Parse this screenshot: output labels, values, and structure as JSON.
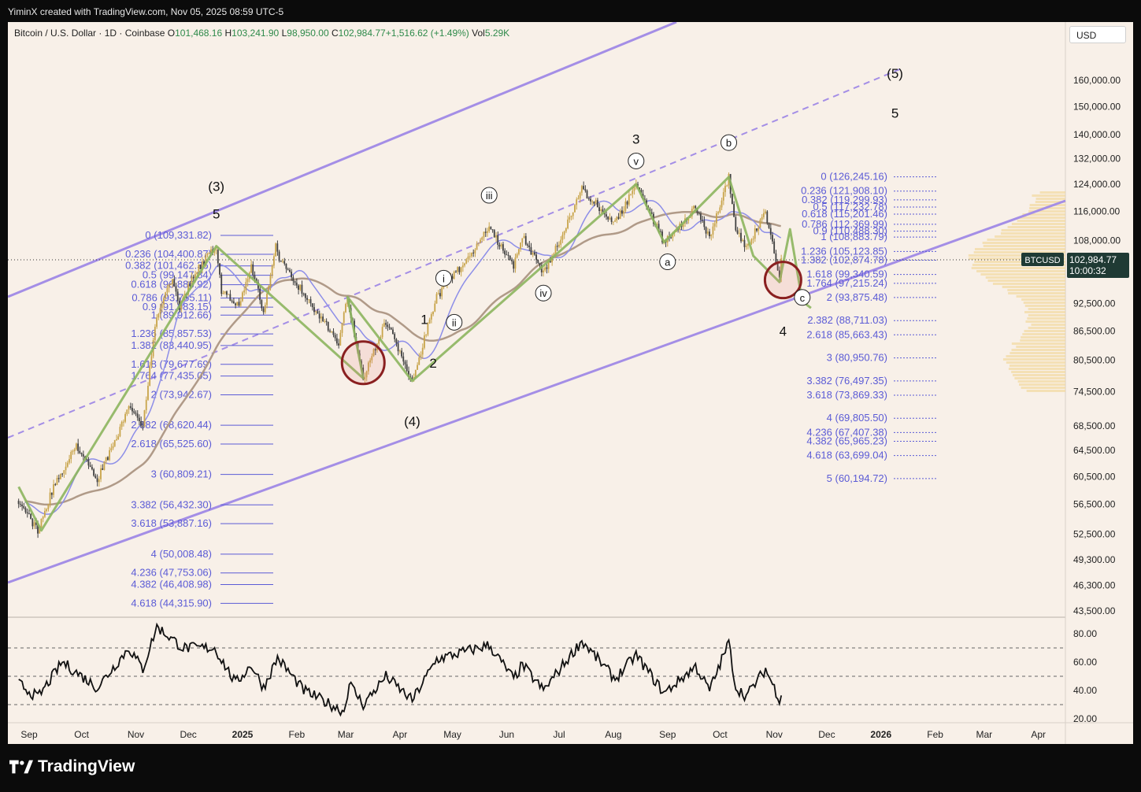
{
  "header": "YiminX created with TradingView.com, Nov 05, 2025 08:59 UTC-5",
  "brand": "TradingView",
  "symbol": {
    "title": "Bitcoin / U.S. Dollar · 1D · Coinbase",
    "o_label": "O",
    "o": "101,468.16",
    "h_label": "H",
    "h": "103,241.90",
    "l_label": "L",
    "l": "98,950.00",
    "c_label": "C",
    "c": "102,984.77",
    "change": "+1,516.62 (+1.49%)",
    "vol_label": "Vol",
    "vol": "5.29K"
  },
  "currency": "USD",
  "price_tag": {
    "symbol": "BTCUSD",
    "price": "102,984.77",
    "countdown": "10:00:32"
  },
  "colors": {
    "up": "#c8a44a",
    "down": "#404040",
    "channel": "#a48ee6",
    "wave": "#8cb55e",
    "ma_slow": "#b09a88",
    "ma_fast": "#8d8ee8",
    "fib": "#5b5bd6",
    "circle": "#8a2020"
  },
  "chart_data": {
    "type": "line",
    "title": "Bitcoin / U.S. Dollar · 1D · Coinbase",
    "y_scale": "log",
    "price_axis_labels": [
      "160,000.00",
      "150,000.00",
      "140,000.00",
      "132,000.00",
      "124,000.00",
      "116,000.00",
      "108,000.00",
      "92,500.00",
      "86,500.00",
      "80,500.00",
      "74,500.00",
      "68,500.00",
      "64,500.00",
      "60,500.00",
      "56,500.00",
      "52,500.00",
      "49,300.00",
      "46,300.00",
      "43,500.00"
    ],
    "rsi_axis_labels": [
      "80.00",
      "60.00",
      "40.00",
      "20.00"
    ],
    "time_axis_labels": [
      "Sep",
      "Oct",
      "Nov",
      "Dec",
      "2025",
      "Feb",
      "Mar",
      "Apr",
      "May",
      "Jun",
      "Jul",
      "Aug",
      "Sep",
      "Oct",
      "Nov",
      "Dec",
      "2026",
      "Feb",
      "Mar",
      "Apr"
    ],
    "price_waypoints": [
      [
        "2024-08-26",
        57000
      ],
      [
        "2024-09-06",
        53000
      ],
      [
        "2024-09-15",
        59000
      ],
      [
        "2024-09-28",
        65500
      ],
      [
        "2024-10-10",
        60000
      ],
      [
        "2024-10-29",
        72000
      ],
      [
        "2024-11-05",
        68500
      ],
      [
        "2024-11-12",
        88000
      ],
      [
        "2024-11-22",
        98500
      ],
      [
        "2024-11-26",
        91500
      ],
      [
        "2024-12-05",
        100000
      ],
      [
        "2024-12-17",
        106500
      ],
      [
        "2024-12-20",
        95000
      ],
      [
        "2024-12-30",
        92500
      ],
      [
        "2025-01-06",
        101500
      ],
      [
        "2025-01-13",
        90500
      ],
      [
        "2025-01-20",
        106500
      ],
      [
        "2025-01-22",
        103000
      ],
      [
        "2025-02-03",
        96000
      ],
      [
        "2025-02-25",
        84000
      ],
      [
        "2025-03-02",
        94000
      ],
      [
        "2025-03-11",
        77000
      ],
      [
        "2025-03-24",
        88500
      ],
      [
        "2025-04-08",
        76500
      ],
      [
        "2025-04-22",
        94000
      ],
      [
        "2025-05-09",
        103000
      ],
      [
        "2025-05-22",
        111500
      ],
      [
        "2025-06-05",
        101000
      ],
      [
        "2025-06-10",
        109500
      ],
      [
        "2025-06-22",
        99500
      ],
      [
        "2025-07-03",
        109500
      ],
      [
        "2025-07-14",
        122500
      ],
      [
        "2025-08-02",
        112500
      ],
      [
        "2025-08-14",
        124000
      ],
      [
        "2025-08-30",
        107500
      ],
      [
        "2025-09-17",
        117000
      ],
      [
        "2025-09-25",
        108500
      ],
      [
        "2025-10-06",
        126200
      ],
      [
        "2025-10-10",
        110500
      ],
      [
        "2025-10-16",
        106000
      ],
      [
        "2025-10-27",
        115500
      ],
      [
        "2025-11-04",
        99000
      ],
      [
        "2025-11-05",
        102984.77
      ]
    ],
    "rsi_waypoints": [
      [
        "2024-08-26",
        45
      ],
      [
        "2024-09-06",
        35
      ],
      [
        "2024-09-20",
        60
      ],
      [
        "2024-10-10",
        42
      ],
      [
        "2024-10-28",
        70
      ],
      [
        "2024-11-05",
        55
      ],
      [
        "2024-11-13",
        85
      ],
      [
        "2024-11-28",
        70
      ],
      [
        "2024-12-16",
        70
      ],
      [
        "2024-12-28",
        45
      ],
      [
        "2025-01-06",
        58
      ],
      [
        "2025-01-13",
        42
      ],
      [
        "2025-01-21",
        63
      ],
      [
        "2025-02-05",
        40
      ],
      [
        "2025-02-28",
        25
      ],
      [
        "2025-03-03",
        45
      ],
      [
        "2025-03-11",
        30
      ],
      [
        "2025-03-24",
        50
      ],
      [
        "2025-04-08",
        33
      ],
      [
        "2025-04-22",
        62
      ],
      [
        "2025-05-22",
        72
      ],
      [
        "2025-06-05",
        48
      ],
      [
        "2025-06-10",
        58
      ],
      [
        "2025-06-22",
        40
      ],
      [
        "2025-07-14",
        75
      ],
      [
        "2025-08-02",
        48
      ],
      [
        "2025-08-14",
        65
      ],
      [
        "2025-08-30",
        38
      ],
      [
        "2025-09-17",
        57
      ],
      [
        "2025-09-25",
        40
      ],
      [
        "2025-10-06",
        74
      ],
      [
        "2025-10-10",
        42
      ],
      [
        "2025-10-16",
        36
      ],
      [
        "2025-10-27",
        55
      ],
      [
        "2025-11-04",
        34
      ],
      [
        "2025-11-05",
        38
      ]
    ],
    "rsi_levels": [
      70,
      50,
      30
    ],
    "wave_labels": [
      {
        "text": "(3)",
        "date": "2024-12-17",
        "price": 122000,
        "circled": false
      },
      {
        "text": "5",
        "date": "2024-12-17",
        "price": 114000,
        "circled": false
      },
      {
        "text": "(4)",
        "date": "2025-04-08",
        "price": 68500,
        "circled": false
      },
      {
        "text": "1",
        "date": "2025-04-15",
        "price": 88000,
        "circled": false
      },
      {
        "text": "2",
        "date": "2025-04-20",
        "price": 79000,
        "circled": false
      },
      {
        "text": "i",
        "date": "2025-04-26",
        "price": 97500,
        "circled": true
      },
      {
        "text": "ii",
        "date": "2025-05-02",
        "price": 87500,
        "circled": true
      },
      {
        "text": "iii",
        "date": "2025-05-22",
        "price": 119500,
        "circled": true
      },
      {
        "text": "iv",
        "date": "2025-06-22",
        "price": 94000,
        "circled": true
      },
      {
        "text": "v",
        "date": "2025-08-14",
        "price": 130000,
        "circled": true
      },
      {
        "text": "3",
        "date": "2025-08-14",
        "price": 137000,
        "circled": false
      },
      {
        "text": "a",
        "date": "2025-09-01",
        "price": 101500,
        "circled": true
      },
      {
        "text": "b",
        "date": "2025-10-06",
        "price": 136000,
        "circled": true
      },
      {
        "text": "c",
        "date": "2025-11-17",
        "price": 93000,
        "circled": true
      },
      {
        "text": "4",
        "date": "2025-11-06",
        "price": 85500,
        "circled": false
      },
      {
        "text": "(5)",
        "date": "2026-01-09",
        "price": 161000,
        "circled": false
      },
      {
        "text": "5",
        "date": "2026-01-09",
        "price": 146000,
        "circled": false
      }
    ],
    "fib_left": [
      {
        "label": "0 (109,331.82)",
        "price": 109331.82
      },
      {
        "label": "0.236 (104,400.87)",
        "price": 104400.87
      },
      {
        "label": "0.382 (101,462.36)",
        "price": 101462.36
      },
      {
        "label": "0.5 (99,147.84)",
        "price": 99147.84
      },
      {
        "label": "0.618 (96,886.92)",
        "price": 96886.92
      },
      {
        "label": "0.786 (93,755.11)",
        "price": 93755.11
      },
      {
        "label": "0.9 (91,683.15)",
        "price": 91683.15
      },
      {
        "label": "1 (89,912.66)",
        "price": 89912.66
      },
      {
        "label": "1.236 (85,857.53)",
        "price": 85857.53
      },
      {
        "label": "1.382 (83,440.95)",
        "price": 83440.95
      },
      {
        "label": "1.618 (79,677.69)",
        "price": 79677.69
      },
      {
        "label": "1.764 (77,435.05)",
        "price": 77435.05
      },
      {
        "label": "2 (73,942.67)",
        "price": 73942.67
      },
      {
        "label": "2.382 (68,620.44)",
        "price": 68620.44
      },
      {
        "label": "2.618 (65,525.60)",
        "price": 65525.6
      },
      {
        "label": "3 (60,809.21)",
        "price": 60809.21
      },
      {
        "label": "3.382 (56,432.30)",
        "price": 56432.3
      },
      {
        "label": "3.618 (53,887.16)",
        "price": 53887.16
      },
      {
        "label": "4 (50,008.48)",
        "price": 50008.48
      },
      {
        "label": "4.236 (47,753.06)",
        "price": 47753.06
      },
      {
        "label": "4.382 (46,408.98)",
        "price": 46408.98
      },
      {
        "label": "4.618 (44,315.90)",
        "price": 44315.9
      }
    ],
    "fib_right": [
      {
        "label": "0 (126,245.16)",
        "price": 126245.16
      },
      {
        "label": "0.236 (121,908.10)",
        "price": 121908.1
      },
      {
        "label": "0.382 (119,299.93)",
        "price": 119299.93
      },
      {
        "label": "0.5 (117,232.78)",
        "price": 117232.78
      },
      {
        "label": "0.618 (115,201.46)",
        "price": 115201.46
      },
      {
        "label": "0.786 (112,369.99)",
        "price": 112369.99
      },
      {
        "label": "0.9 (110,488.30)",
        "price": 110488.3
      },
      {
        "label": "1 (108,883.79)",
        "price": 108883.79
      },
      {
        "label": "1.236 (105,123.85)",
        "price": 105123.85
      },
      {
        "label": "1.382 (102,874.78)",
        "price": 102874.78
      },
      {
        "label": "1.618 (99,340.59)",
        "price": 99340.59
      },
      {
        "label": "1.764 (97,215.24)",
        "price": 97215.24
      },
      {
        "label": "2 (93,875.48)",
        "price": 93875.48
      },
      {
        "label": "2.382 (88,711.03)",
        "price": 88711.03
      },
      {
        "label": "2.618 (85,663.43)",
        "price": 85663.43
      },
      {
        "label": "3 (80,950.76)",
        "price": 80950.76
      },
      {
        "label": "3.382 (76,497.35)",
        "price": 76497.35
      },
      {
        "label": "3.618 (73,869.33)",
        "price": 73869.33
      },
      {
        "label": "4 (69,805.50)",
        "price": 69805.5
      },
      {
        "label": "4.236 (67,407.38)",
        "price": 67407.38
      },
      {
        "label": "4.382 (65,965.23)",
        "price": 65965.23
      },
      {
        "label": "4.618 (63,699.04)",
        "price": 63699.04
      },
      {
        "label": "5 (60,194.72)",
        "price": 60194.72
      }
    ]
  }
}
